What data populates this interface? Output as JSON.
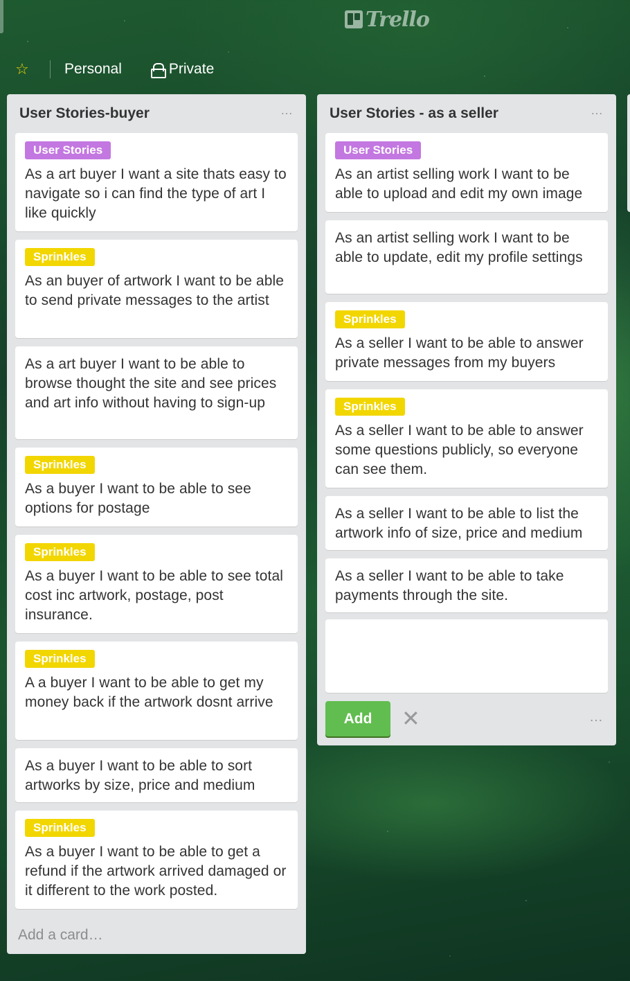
{
  "app": {
    "logo_text": "Trello"
  },
  "board": {
    "personal_label": "Personal",
    "private_label": "Private"
  },
  "lists": [
    {
      "title": "User Stories-buyer",
      "menu": "…",
      "add_card": "Add a card…",
      "cards": [
        {
          "label": "User Stories",
          "text": "As a art buyer I want a site thats easy to navigate so i can find the type of art I like quickly"
        },
        {
          "label": "Sprinkles",
          "text": "As an buyer of artwork I want to be able to send private messages to the artist"
        },
        {
          "label": "",
          "text": "As a art buyer I want to be able to browse thought the site and see prices and art info without having to sign-up"
        },
        {
          "label": "Sprinkles",
          "text": "As a buyer I want to be able to see options for postage"
        },
        {
          "label": "Sprinkles",
          "text": "As a buyer I want to be able to see total cost inc artwork, postage, post insurance."
        },
        {
          "label": "Sprinkles",
          "text": "A a buyer I want to be able to get my money back if the artwork dosnt arrive"
        },
        {
          "label": "",
          "text": "As a buyer I want to be able to sort artworks by size, price and medium"
        },
        {
          "label": "Sprinkles",
          "text": "As a buyer I want to be able to get a refund if the artwork arrived damaged or it different to the work posted."
        }
      ]
    },
    {
      "title": "User Stories - as a seller",
      "menu": "…",
      "cards": [
        {
          "label": "User Stories",
          "text": "As an artist selling work I want to be able to upload and edit my own image"
        },
        {
          "label": "",
          "text": "As an artist selling work I want to be able to update, edit my profile settings"
        },
        {
          "label": "Sprinkles",
          "text": "As a seller I want to be able to answer private messages from my buyers"
        },
        {
          "label": "Sprinkles",
          "text": "As a seller I want to be able to answer some questions publicly, so everyone can see them."
        },
        {
          "label": "",
          "text": "As a seller I want to be able to list the artwork info of size, price and medium"
        },
        {
          "label": "",
          "text": "As a seller I want to be able to take payments through the site."
        }
      ],
      "composer": {
        "value": "",
        "add_button": "Add",
        "menu": "…"
      }
    }
  ],
  "colors": {
    "label_purple": "#c377e0",
    "label_yellow": "#f2d600",
    "add_button": "#61bd4f",
    "list_bg": "#e2e4e6"
  }
}
